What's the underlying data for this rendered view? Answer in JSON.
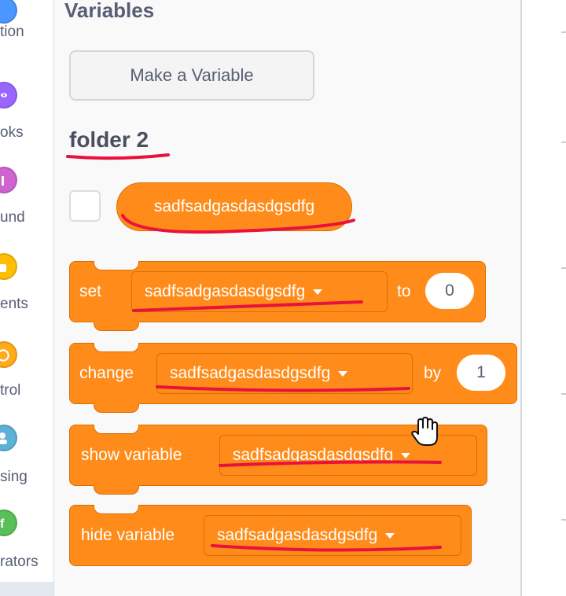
{
  "categories": [
    {
      "label": "tion",
      "color": "#4c97ff"
    },
    {
      "label": "oks",
      "color": "#9966ff"
    },
    {
      "label": "und",
      "color": "#cf63cf"
    },
    {
      "label": "ents",
      "color": "#ffbf00"
    },
    {
      "label": "trol",
      "color": "#ffab19"
    },
    {
      "label": "sing",
      "color": "#5cb1d6"
    },
    {
      "label": "rators",
      "color": "#59c059"
    }
  ],
  "palette": {
    "heading": "Variables",
    "make_variable_button": "Make a Variable",
    "folder_label": "folder 2",
    "variable_reporter": "sadfsadgasdasdgsdfg"
  },
  "blocks": {
    "set": {
      "keyword": "set",
      "variable": "sadfsadgasdasdgsdfg",
      "connector": "to",
      "value": "0"
    },
    "change": {
      "keyword": "change",
      "variable": "sadfsadgasdasdgsdfg",
      "connector": "by",
      "value": "1"
    },
    "show": {
      "keyword": "show variable",
      "variable": "sadfsadgasdasdgsdfg"
    },
    "hide": {
      "keyword": "hide variable",
      "variable": "sadfsadgasdasdgsdfg"
    }
  },
  "colors": {
    "variables_orange": "#ff8c1a",
    "annotation_red": "#e8123c"
  }
}
